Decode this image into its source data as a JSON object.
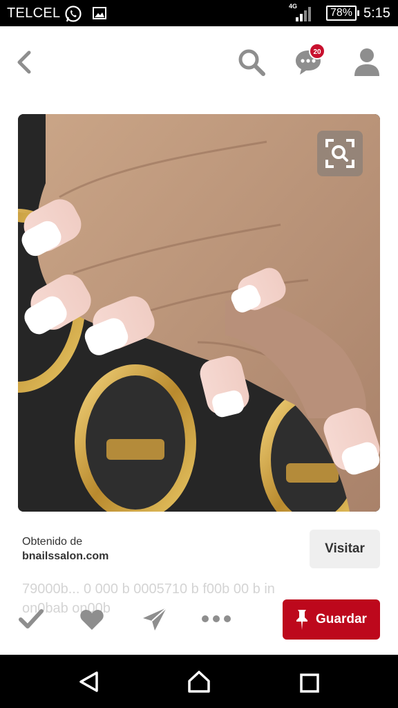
{
  "status_bar": {
    "carrier": "TELCEL",
    "network": "4G",
    "battery": "78%",
    "time": "5:15",
    "icons": [
      "whatsapp-icon",
      "image-icon",
      "signal-icon",
      "battery-icon"
    ]
  },
  "header": {
    "icons": [
      "back-icon",
      "search-icon",
      "chat-icon",
      "profile-icon"
    ],
    "notification_count": "20"
  },
  "pin": {
    "image_description_icon": "visual-search-icon",
    "source_label": "Obtenido de",
    "source_domain": "bnailssalon.com",
    "visit_label": "Visitar",
    "faded_text_line1": "79000b... 0 000 b 0005710 b f00b 00 b in",
    "faded_text_line2": "on0bab on00b"
  },
  "actions": {
    "icons": [
      "check-icon",
      "heart-icon",
      "send-icon",
      "more-icon"
    ],
    "save_label": "Guardar"
  },
  "colors": {
    "brand_red": "#bd081c",
    "badge_red": "#c8102e",
    "icon_gray": "#8e8e8e"
  }
}
